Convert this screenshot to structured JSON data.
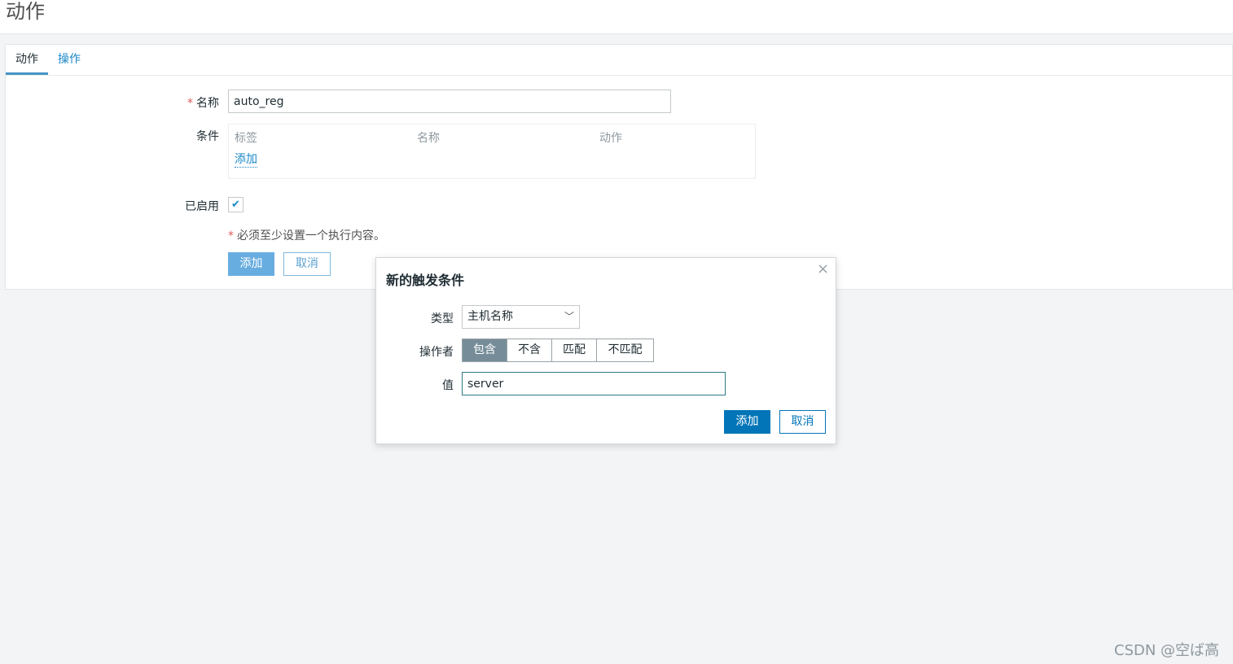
{
  "page": {
    "title": "动作"
  },
  "tabs": [
    {
      "label": "动作",
      "active": true
    },
    {
      "label": "操作",
      "active": false
    }
  ],
  "form": {
    "name_label": "名称",
    "name_value": "auto_reg",
    "conditions_label": "条件",
    "conditions_headers": [
      "标签",
      "名称",
      "动作"
    ],
    "conditions_add": "添加",
    "enabled_label": "已启用",
    "enabled_checked": true,
    "required_note": "必须至少设置一个执行内容。",
    "add_button": "添加",
    "cancel_button": "取消",
    "required_mark": "*"
  },
  "modal": {
    "title": "新的触发条件",
    "close": "×",
    "type_label": "类型",
    "type_value": "主机名称",
    "operator_label": "操作者",
    "operators": [
      "包含",
      "不含",
      "匹配",
      "不匹配"
    ],
    "operator_selected": "包含",
    "value_label": "值",
    "value": "server",
    "add_button": "添加",
    "cancel_button": "取消"
  },
  "watermark": "CSDN @空ば高",
  "colors": {
    "accent": "#0275b8",
    "link": "#1a88c7",
    "required": "#e45959",
    "segment_selected": "#768d99"
  }
}
